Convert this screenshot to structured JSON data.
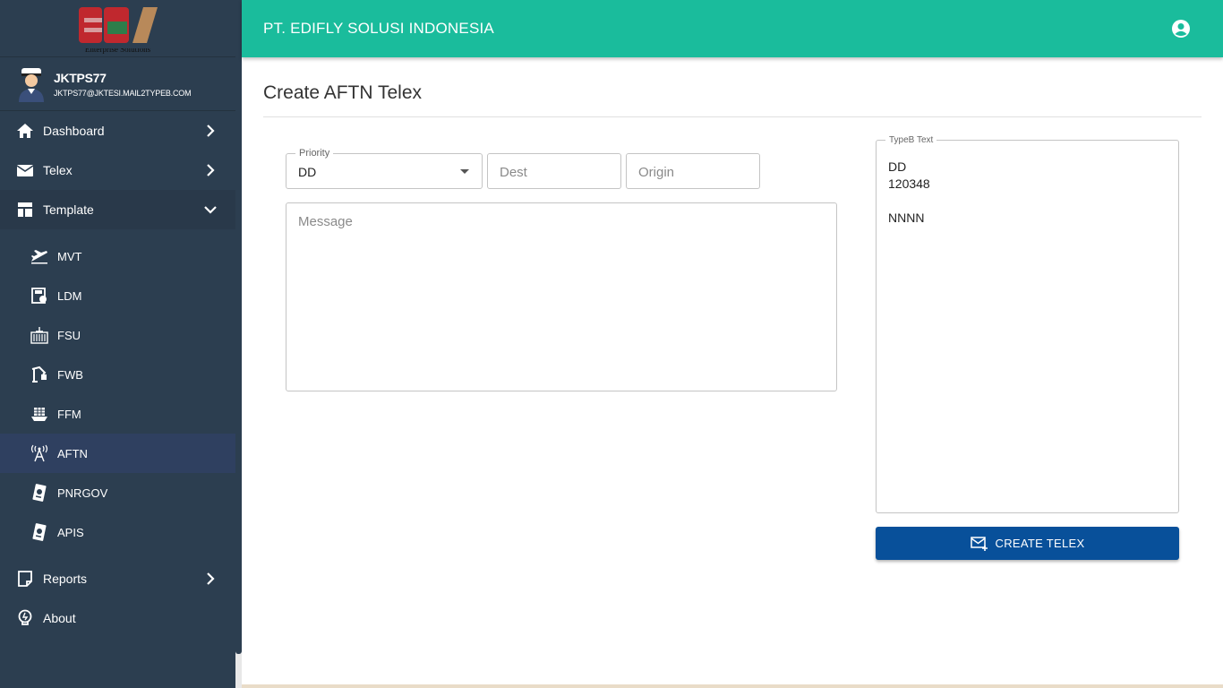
{
  "brand": {
    "logo_text": "ESI",
    "logo_subtitle": "Enterprise Solutions"
  },
  "user": {
    "name": "JKTPS77",
    "email": "JKTPS77@JKTESI.MAIL2TYPEB.COM"
  },
  "sidebar": {
    "items": [
      {
        "label": "Dashboard",
        "icon": "home-icon",
        "state": "collapsed"
      },
      {
        "label": "Telex",
        "icon": "mail-icon",
        "state": "collapsed"
      },
      {
        "label": "Template",
        "icon": "template-icon",
        "state": "expanded"
      }
    ],
    "template_subitems": [
      {
        "label": "MVT",
        "icon": "plane-icon"
      },
      {
        "label": "LDM",
        "icon": "load-icon"
      },
      {
        "label": "FSU",
        "icon": "container-icon"
      },
      {
        "label": "FWB",
        "icon": "crane-icon"
      },
      {
        "label": "FFM",
        "icon": "ship-icon"
      },
      {
        "label": "AFTN",
        "icon": "antenna-icon",
        "active": true
      },
      {
        "label": "PNRGOV",
        "icon": "passport-icon"
      },
      {
        "label": "APIS",
        "icon": "passport-icon"
      }
    ],
    "bottom_items": [
      {
        "label": "Reports",
        "icon": "note-icon"
      },
      {
        "label": "About",
        "icon": "bulb-icon"
      }
    ]
  },
  "header": {
    "title": "PT. EDIFLY SOLUSI INDONESIA",
    "account_icon": "account-circle-icon"
  },
  "page": {
    "title": "Create AFTN Telex"
  },
  "form": {
    "priority_label": "Priority",
    "priority_value": "DD",
    "dest_placeholder": "Dest",
    "origin_placeholder": "Origin",
    "message_placeholder": "Message",
    "typeb_label": "TypeB Text",
    "typeb_lines": [
      "DD",
      "120348",
      "",
      "NNNN"
    ],
    "create_button": "CREATE TELEX"
  },
  "colors": {
    "sidebar_bg": "#2c3e50",
    "topbar_bg": "#1abc9c",
    "button_bg": "#08509a",
    "active_item_bg": "#2f4060"
  }
}
